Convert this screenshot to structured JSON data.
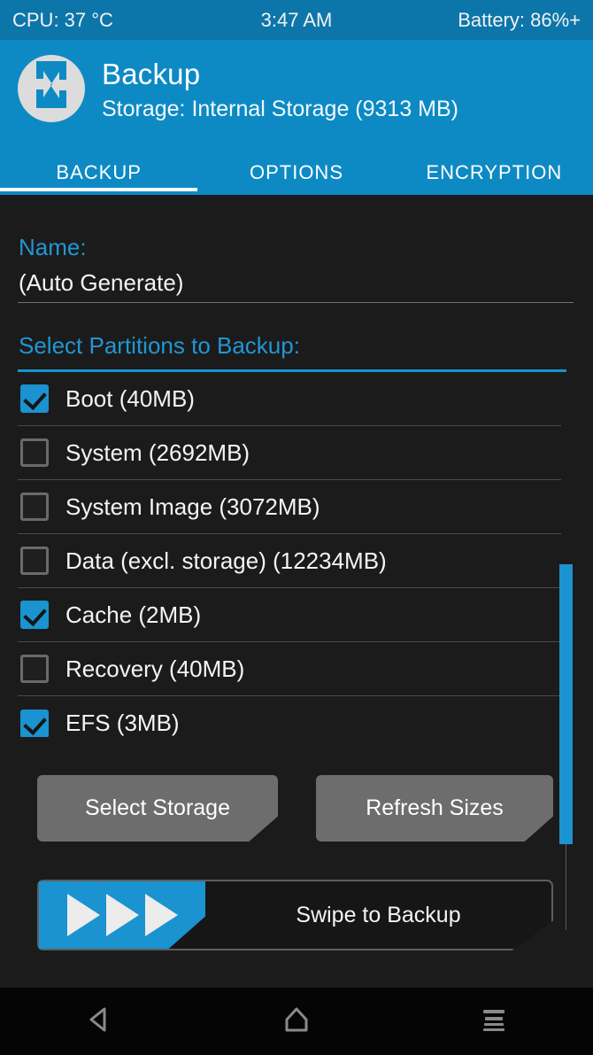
{
  "statusbar": {
    "cpu": "CPU: 37 °C",
    "clock": "3:47 AM",
    "battery": "Battery: 86%+"
  },
  "header": {
    "logo_icon": "twrp-logo-icon",
    "title": "Backup",
    "subtitle": "Storage: Internal Storage (9313 MB)",
    "tabs": [
      {
        "label": "BACKUP",
        "active": true
      },
      {
        "label": "OPTIONS",
        "active": false
      },
      {
        "label": "ENCRYPTION",
        "active": false
      }
    ]
  },
  "main": {
    "name_label": "Name:",
    "name_value": "(Auto Generate)",
    "partitions_label": "Select Partitions to Backup:",
    "partitions": [
      {
        "label": "Boot (40MB)",
        "checked": true
      },
      {
        "label": "System (2692MB)",
        "checked": false
      },
      {
        "label": "System Image (3072MB)",
        "checked": false
      },
      {
        "label": "Data (excl. storage) (12234MB)",
        "checked": false
      },
      {
        "label": "Cache (2MB)",
        "checked": true
      },
      {
        "label": "Recovery (40MB)",
        "checked": false
      },
      {
        "label": "EFS (3MB)",
        "checked": true
      }
    ],
    "buttons": {
      "select_storage": "Select Storage",
      "refresh_sizes": "Refresh Sizes"
    },
    "swipe": {
      "text": "Swipe to Backup",
      "handle_icon": "triple-play-arrow-icon"
    }
  },
  "navbar": {
    "back_icon": "back-triangle-icon",
    "home_icon": "home-icon",
    "menu_icon": "menu-lines-icon"
  },
  "colors": {
    "accent_blue": "#1a93d0",
    "header_blue": "#0d8ac4",
    "statusbar_blue": "#0c76aa",
    "background": "#1b1b1b",
    "button_gray": "#6d6d6d"
  }
}
